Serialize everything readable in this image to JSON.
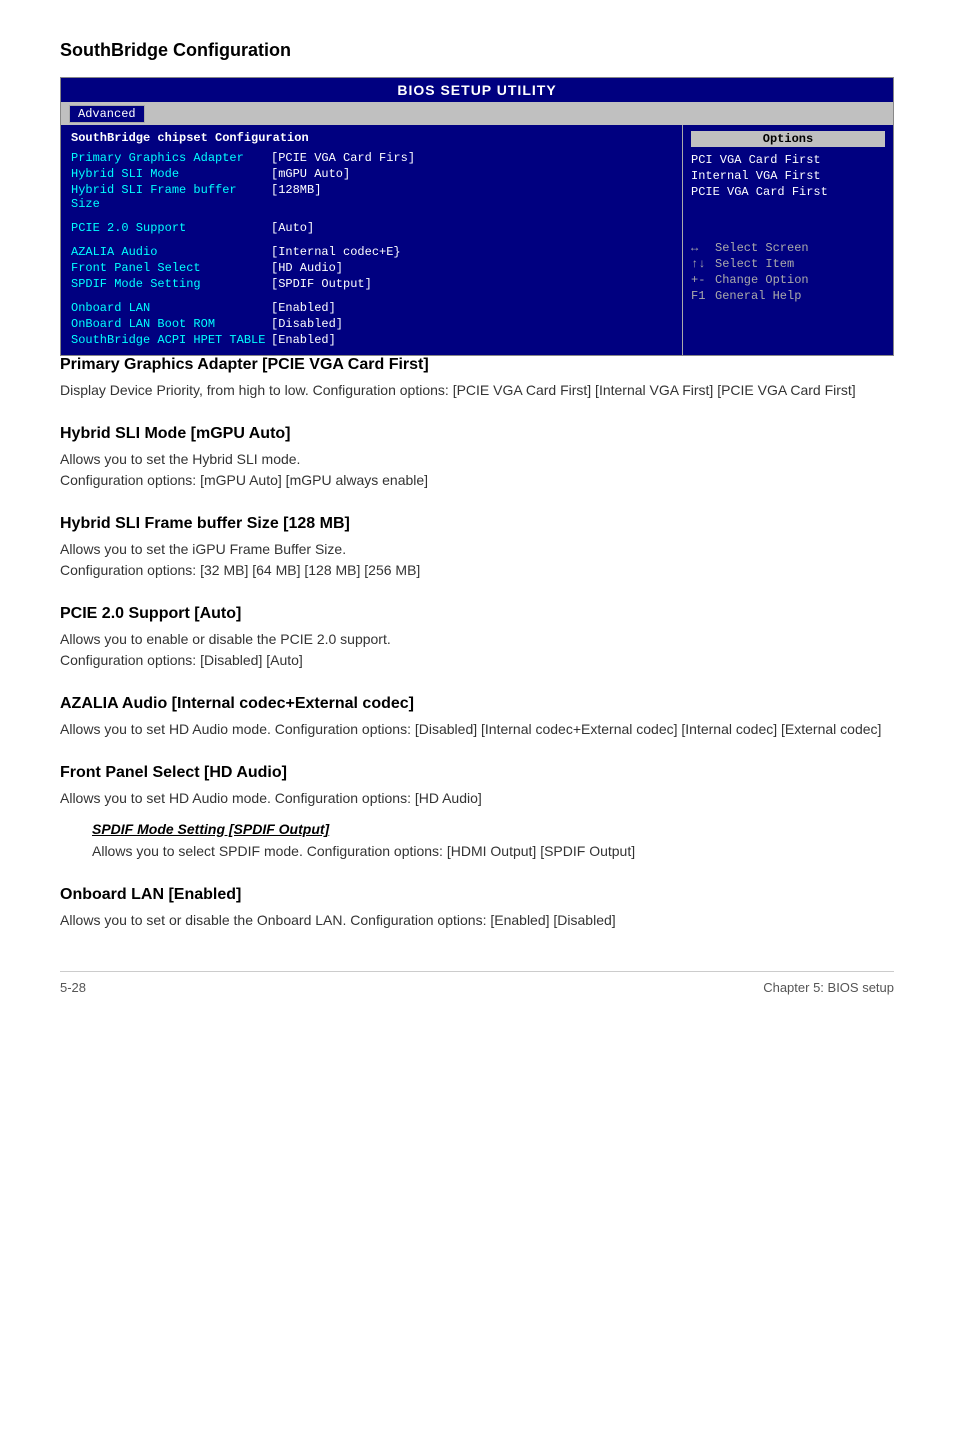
{
  "pageTitle": "SouthBridge Configuration",
  "bios": {
    "header": "BIOS SETUP UTILITY",
    "tab": "Advanced",
    "sectionTitle": "SouthBridge chipset Configuration",
    "optionsTitle": "Options",
    "rows": [
      {
        "label": "Primary Graphics Adapter",
        "value": "[PCIE VGA Card Firs]"
      },
      {
        "label": "Hybrid SLI Mode",
        "value": "[mGPU Auto]"
      },
      {
        "label": "Hybrid SLI Frame buffer Size",
        "value": "[128MB]"
      }
    ],
    "rows2": [
      {
        "label": "PCIE 2.0 Support",
        "value": "[Auto]"
      }
    ],
    "rows3": [
      {
        "label": "AZALIA Audio",
        "value": "[Internal codec+E}"
      },
      {
        "label": "Front Panel Select",
        "value": "[HD Audio]"
      },
      {
        "label": " SPDIF Mode Setting",
        "value": "[SPDIF Output]"
      }
    ],
    "rows4": [
      {
        "label": "Onboard LAN",
        "value": "[Enabled]"
      },
      {
        "label": " OnBoard LAN Boot ROM",
        "value": "[Disabled]"
      },
      {
        "label": "SouthBridge ACPI HPET TABLE",
        "value": "[Enabled]"
      }
    ],
    "options": [
      "PCI VGA Card First",
      "Internal VGA First",
      "PCIE VGA Card First"
    ],
    "navItems": [
      {
        "key": "↔",
        "desc": "Select Screen"
      },
      {
        "key": "↑↓",
        "desc": "Select Item"
      },
      {
        "key": "+-",
        "desc": "Change Option"
      },
      {
        "key": "F1",
        "desc": "General Help"
      }
    ]
  },
  "sections": [
    {
      "id": "primary-graphics",
      "heading": "Primary Graphics Adapter [PCIE VGA Card First]",
      "text": "Display Device Priority, from high to low. Configuration options: [PCIE VGA Card First] [Internal VGA First] [PCIE VGA Card First]",
      "sub": null
    },
    {
      "id": "hybrid-sli-mode",
      "heading": "Hybrid SLI Mode [mGPU Auto]",
      "text": "Allows you to set the Hybrid SLI mode.\nConfiguration options: [mGPU Auto] [mGPU always enable]",
      "sub": null
    },
    {
      "id": "hybrid-sli-frame",
      "heading": "Hybrid SLI Frame buffer Size [128 MB]",
      "text": "Allows you to set the iGPU Frame Buffer Size.\nConfiguration options: [32 MB] [64 MB] [128 MB] [256 MB]",
      "sub": null
    },
    {
      "id": "pcie-support",
      "heading": "PCIE 2.0 Support [Auto]",
      "text": "Allows you to enable or disable the PCIE 2.0 support.\nConfiguration options: [Disabled] [Auto]",
      "sub": null
    },
    {
      "id": "azalia-audio",
      "heading": "AZALIA Audio [Internal codec+External codec]",
      "text": "Allows you to set HD Audio mode. Configuration options: [Disabled] [Internal codec+External codec] [Internal codec] [External codec]",
      "sub": null
    },
    {
      "id": "front-panel",
      "heading": "Front Panel Select [HD Audio]",
      "text": "Allows you to set HD Audio mode. Configuration options: [HD Audio]",
      "sub": {
        "heading": "SPDIF Mode Setting [SPDIF Output]",
        "text": "Allows you to select SPDIF mode. Configuration options: [HDMI Output] [SPDIF Output]"
      }
    },
    {
      "id": "onboard-lan",
      "heading": "Onboard LAN [Enabled]",
      "text": "Allows you to set or disable the Onboard LAN. Configuration options: [Enabled] [Disabled]",
      "sub": null
    }
  ],
  "footer": {
    "left": "5-28",
    "right": "Chapter 5: BIOS setup"
  }
}
